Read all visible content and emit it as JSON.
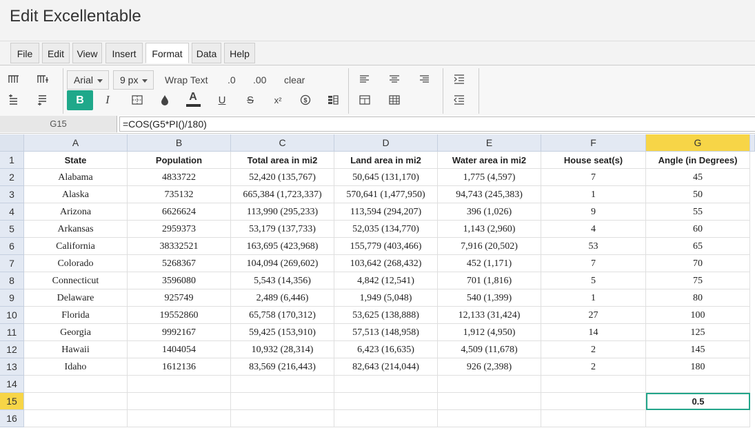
{
  "app": {
    "title": "Edit Excellentable"
  },
  "menu": [
    "File",
    "Edit",
    "View",
    "Insert",
    "Format",
    "Data",
    "Help"
  ],
  "active_menu": "Format",
  "toolbar": {
    "font": "Arial",
    "size": "9 px",
    "wrap_text": "Wrap Text",
    "decrease_decimal": ".0",
    "increase_decimal": ".00",
    "clear": "clear",
    "bold": "B",
    "italic": "I",
    "font_color": "A",
    "underline": "U",
    "strike": "S",
    "superscript": "x²",
    "accent_color": "#1fa88a"
  },
  "formula_bar": {
    "cell_ref": "G15",
    "formula": "=COS(G5*PI()/180)"
  },
  "columns": [
    "A",
    "B",
    "C",
    "D",
    "E",
    "F",
    "G"
  ],
  "rows": [
    "1",
    "2",
    "3",
    "4",
    "5",
    "6",
    "7",
    "8",
    "9",
    "10",
    "11",
    "12",
    "13",
    "14",
    "15",
    "16"
  ],
  "table": [
    [
      "State",
      "Population",
      "Total area in mi2",
      "Land area in mi2",
      "Water area in mi2",
      "House seat(s)",
      "Angle (in Degrees)"
    ],
    [
      "Alabama",
      "4833722",
      "52,420 (135,767)",
      "50,645 (131,170)",
      "1,775 (4,597)",
      "7",
      "45"
    ],
    [
      "Alaska",
      "735132",
      "665,384 (1,723,337)",
      "570,641 (1,477,950)",
      "94,743 (245,383)",
      "1",
      "50"
    ],
    [
      "Arizona",
      "6626624",
      "113,990 (295,233)",
      "113,594 (294,207)",
      "396 (1,026)",
      "9",
      "55"
    ],
    [
      "Arkansas",
      "2959373",
      "53,179 (137,733)",
      "52,035 (134,770)",
      "1,143 (2,960)",
      "4",
      "60"
    ],
    [
      "California",
      "38332521",
      "163,695 (423,968)",
      "155,779 (403,466)",
      "7,916 (20,502)",
      "53",
      "65"
    ],
    [
      "Colorado",
      "5268367",
      "104,094 (269,602)",
      "103,642 (268,432)",
      "452 (1,171)",
      "7",
      "70"
    ],
    [
      "Connecticut",
      "3596080",
      "5,543 (14,356)",
      "4,842 (12,541)",
      "701 (1,816)",
      "5",
      "75"
    ],
    [
      "Delaware",
      "925749",
      "2,489 (6,446)",
      "1,949 (5,048)",
      "540 (1,399)",
      "1",
      "80"
    ],
    [
      "Florida",
      "19552860",
      "65,758 (170,312)",
      "53,625 (138,888)",
      "12,133 (31,424)",
      "27",
      "100"
    ],
    [
      "Georgia",
      "9992167",
      "59,425 (153,910)",
      "57,513 (148,958)",
      "1,912 (4,950)",
      "14",
      "125"
    ],
    [
      "Hawaii",
      "1404054",
      "10,932 (28,314)",
      "6,423 (16,635)",
      "4,509 (11,678)",
      "2",
      "145"
    ],
    [
      "Idaho",
      "1612136",
      "83,569 (216,443)",
      "82,643 (214,044)",
      "926 (2,398)",
      "2",
      "180"
    ],
    [
      "",
      "",
      "",
      "",
      "",
      "",
      ""
    ],
    [
      "",
      "",
      "",
      "",
      "",
      "",
      "0.5"
    ],
    [
      "",
      "",
      "",
      "",
      "",
      "",
      ""
    ]
  ],
  "selection": {
    "column": "G",
    "row": "15",
    "highlight_color": "#f7d547"
  }
}
